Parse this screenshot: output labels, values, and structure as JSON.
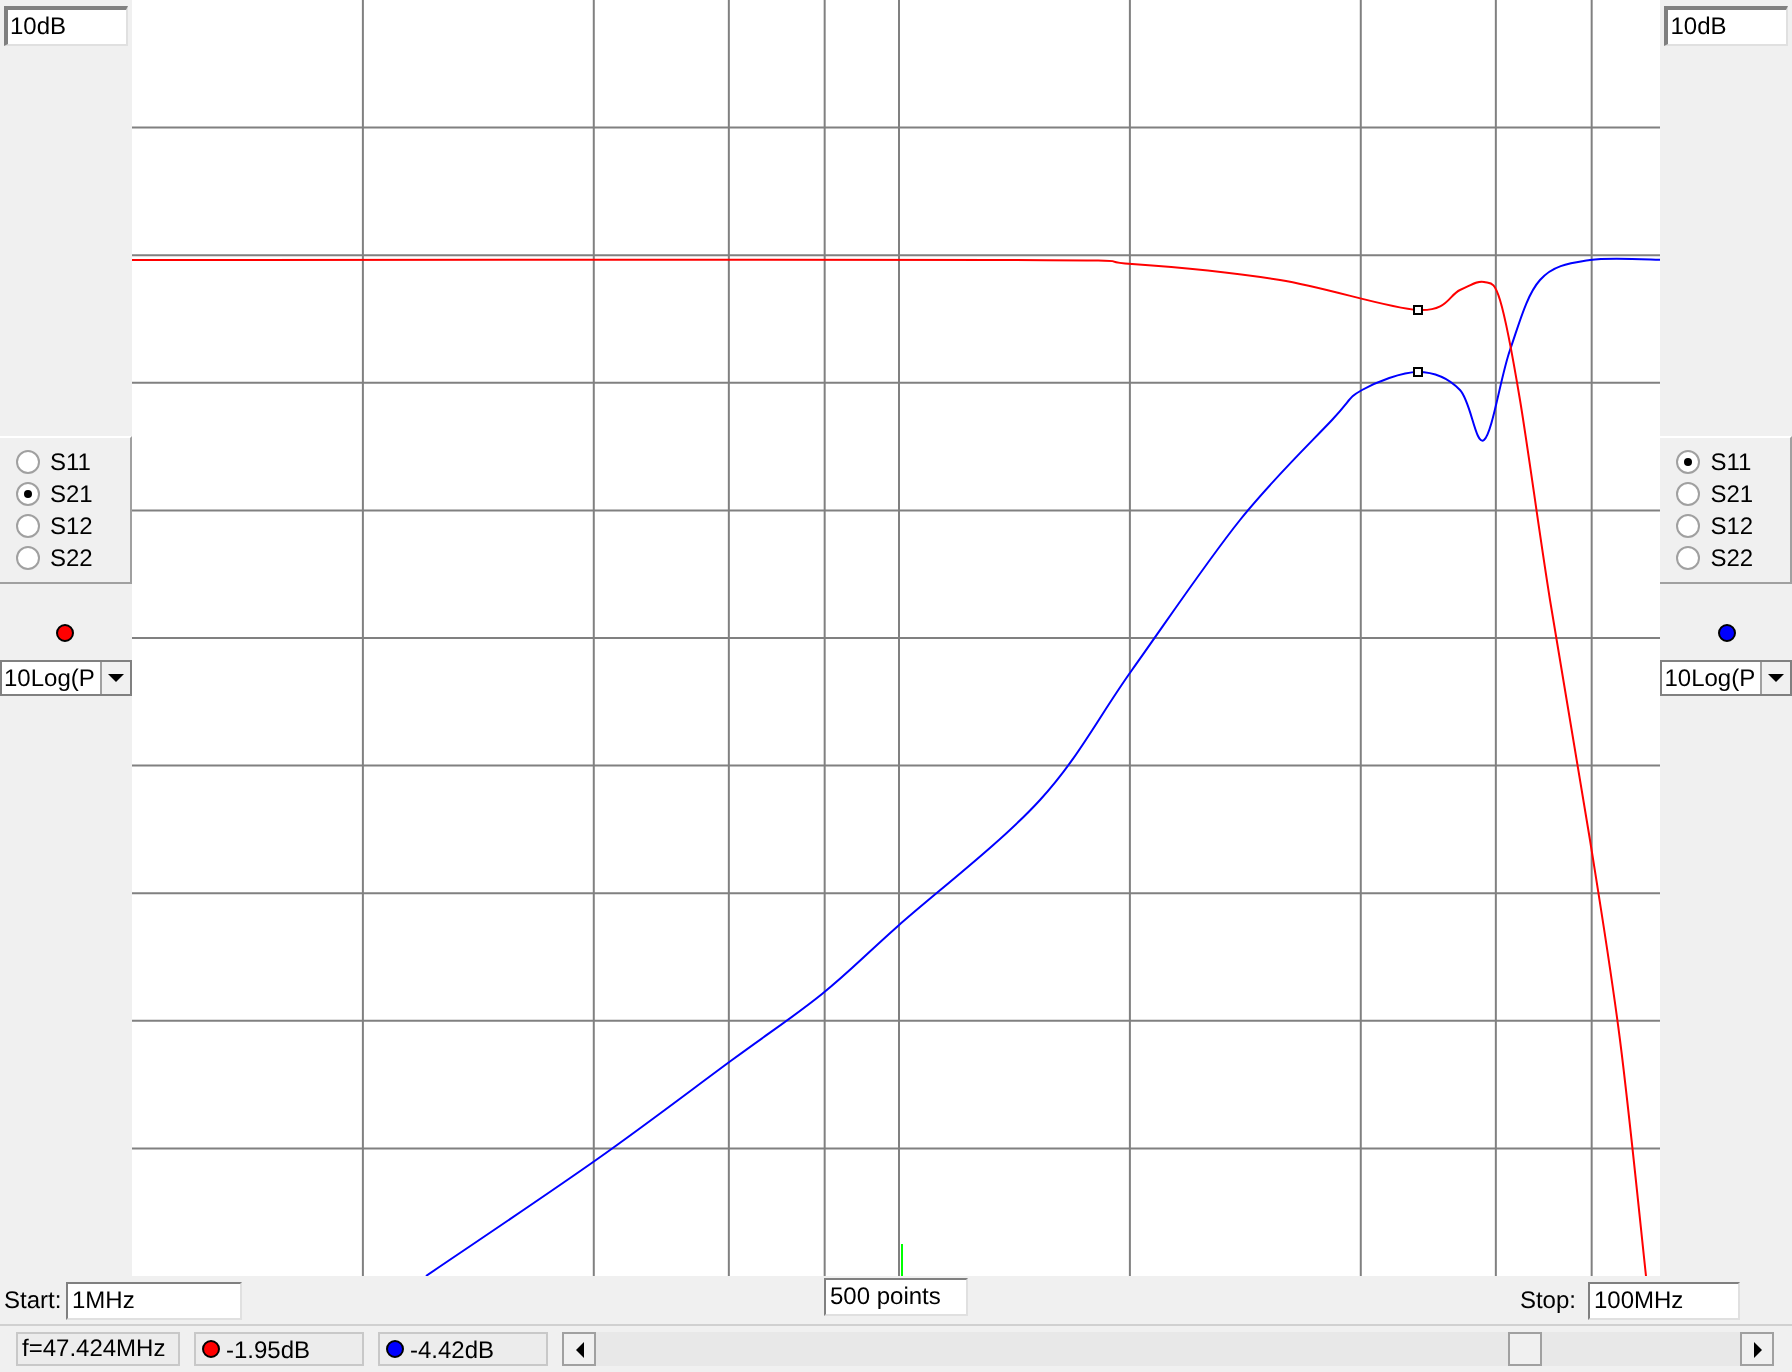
{
  "left_panel": {
    "scale": "10dB",
    "params": [
      {
        "label": "S11",
        "selected": false
      },
      {
        "label": "S21",
        "selected": true
      },
      {
        "label": "S12",
        "selected": false
      },
      {
        "label": "S22",
        "selected": false
      }
    ],
    "color": "#ff0000",
    "format": "10Log(P"
  },
  "right_panel": {
    "scale": "10dB",
    "params": [
      {
        "label": "S11",
        "selected": true
      },
      {
        "label": "S21",
        "selected": false
      },
      {
        "label": "S12",
        "selected": false
      },
      {
        "label": "S22",
        "selected": false
      }
    ],
    "color": "#0000ff",
    "format": "10Log(P"
  },
  "sweep": {
    "start_label": "Start:",
    "start": "1MHz",
    "points": "500 points",
    "stop_label": "Stop:",
    "stop": "100MHz"
  },
  "status_bar": {
    "frequency": "f=47.424MHz",
    "readouts": [
      {
        "value": "-1.95dB",
        "color": "#ff0000"
      },
      {
        "value": "-4.42dB",
        "color": "#0000ff"
      }
    ]
  }
}
